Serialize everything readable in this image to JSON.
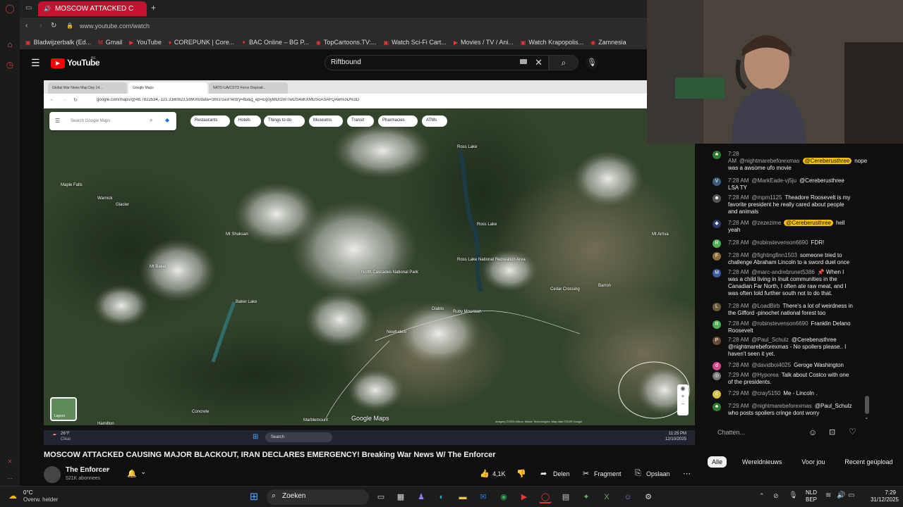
{
  "browser": {
    "active_tab": "MOSCOW ATTACKED C",
    "url": "www.youtube.com/watch",
    "bookmarks": [
      "Bladwijzerbalk (Ed...",
      "Gmail",
      "YouTube",
      "COREPUNK | Core...",
      "BAC Online – BG P...",
      "TopCartoons.TV:...",
      "Watch Sci-Fi Cart...",
      "Movies / TV / Ani...",
      "Watch Krapopolis...",
      "Zamnesia"
    ]
  },
  "youtube": {
    "logo_text": "YouTube",
    "logo_region": "BE",
    "search_value": "Riftbound"
  },
  "video": {
    "inner_tabs": [
      "Global War News Map Day 14...",
      "Google Maps",
      "NATO-UA/CSTO Force Disposit..."
    ],
    "inner_url": "google.com/maps/@48.7822534,-121.3160823,5990m/data=!3m1!1e3?entry=ttu&g_ep=EgoyMDI1MTIwOS4xKXMDSoASAFQAw%3D%3D",
    "map_search_placeholder": "Search Google Maps",
    "chips": [
      "Restaurants",
      "Hotels",
      "Things to do",
      "Museums",
      "Transit",
      "Pharmacies",
      "ATMs"
    ],
    "map_labels": [
      "Maple Falls",
      "Warnick",
      "Glacier",
      "Mt Shuksan",
      "Mt Baker",
      "Baker Lake",
      "Ross Lake National Recreation Area",
      "North Cascades National Park",
      "Ross Lake",
      "Diablo",
      "Ruby Mountain",
      "Newhalem",
      "Cedar Crossing",
      "Barron",
      "Concrete",
      "Marblemount",
      "Hamilton",
      "Mt Arriva",
      "Ross Lake"
    ],
    "layers_label": "Layers",
    "gmaps_logo": "Google Maps",
    "weather": "26°F",
    "weather_sub": "Clear",
    "task_search": "Search",
    "time": "11:25 PM",
    "date": "12/10/2025",
    "footer_credit": "Imagery ©2025 Airbus, Maxar Technologies, Map data ©2025 Google"
  },
  "chat": {
    "messages": [
      {
        "time": "7:28 AM",
        "user": "@nightmarebeforexmas",
        "pill": "@Cereberusthree",
        "text": "nope was a awsome ufo movie",
        "color": "#2e7d32",
        "initial": "♣"
      },
      {
        "time": "7:28 AM",
        "user": "@MarkEade-vj5ju",
        "text": "@Cereberusthree LSA TY",
        "color": "#3d5a7a",
        "initial": "V"
      },
      {
        "time": "7:28 AM",
        "user": "@mpm1125",
        "text": "Theadore Roosevelt is my favorite president he really cared about people and animals",
        "color": "#555",
        "initial": "☻"
      },
      {
        "time": "7:28 AM",
        "user": "@zezezime",
        "pill": "@Cereberusthree",
        "text": "hell yeah",
        "color": "#2a3a6a",
        "initial": "◆"
      },
      {
        "time": "7:28 AM",
        "user": "@robinstevenson6690",
        "text": "FDR!",
        "color": "#4caf50",
        "initial": "R"
      },
      {
        "time": "7:28 AM",
        "user": "@fightingfinn1503",
        "text": "someone tried to challenge Abraham Lincoln to a sword duel once",
        "color": "#8d6e3a",
        "initial": "F"
      },
      {
        "time": "7:28 AM",
        "user": "@marc-andrebrunet5386",
        "text": "📌 When I was a child living in Inuit communities in the Canadian Far North, I often ate raw meat, and I was often told further south not to do that.",
        "color": "#3a5a9a",
        "initial": "M"
      },
      {
        "time": "7:28 AM",
        "user": "@LoadBirb",
        "text": "There's a lot of weirdness in the Gifford -pinochet national forest too",
        "color": "#6a5a3a",
        "initial": "L"
      },
      {
        "time": "7:28 AM",
        "user": "@robinstevenson6690",
        "text": "Franklin Delano Roosevelt",
        "color": "#4caf50",
        "initial": "R"
      },
      {
        "time": "7:28 AM",
        "user": "@Paul_Schulz",
        "text": "@Cereberusthree @nightmarebeforexmas - No spoilers please.. I haven't seen it yet.",
        "color": "#6a4a3a",
        "initial": "P"
      },
      {
        "time": "7:28 AM",
        "user": "@davidboi4025",
        "text": "Geroge Washington",
        "color": "#d04a8a",
        "initial": "d"
      },
      {
        "time": "7:29 AM",
        "user": "@Hyporea",
        "text": "Talk about Costco with one of the presidents.",
        "color": "#777",
        "initial": "◎"
      },
      {
        "time": "7:29 AM",
        "user": "@cray5150",
        "text": "Me - Lincoln .",
        "color": "#d4c24a",
        "initial": "c"
      },
      {
        "time": "7:29 AM",
        "user": "@nightmarebeforexmas",
        "text": "@Paul_Schulz who posts spoilers cringe dont worry",
        "color": "#2e7d32",
        "initial": "♣"
      }
    ],
    "input_placeholder": "Chatten...",
    "filters": [
      "Alle",
      "Wereldnieuws",
      "Voor jou",
      "Recent geüpload"
    ]
  },
  "video_title": "MOSCOW ATTACKED CAUSING MAJOR BLACKOUT, IRAN DECLARES EMERGENCY! Breaking War News W/ The Enforcer",
  "channel": {
    "name": "The Enforcer",
    "subs": "521K abonnees",
    "likes": "4,1K",
    "share": "Delen",
    "clip": "Fragment",
    "save": "Opslaan"
  },
  "taskbar": {
    "weather_temp": "0°C",
    "weather_desc": "Overw. helder",
    "search": "Zoeken",
    "lang1": "NLD",
    "lang2": "BEP",
    "time": "7:29",
    "date": "31/12/2025"
  }
}
